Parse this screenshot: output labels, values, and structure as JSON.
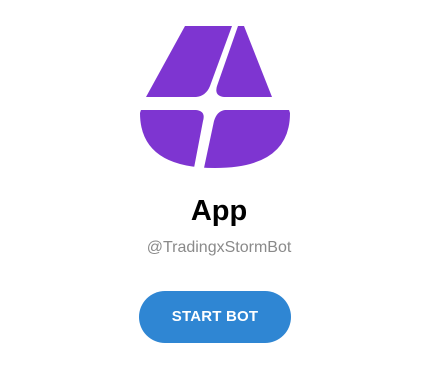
{
  "bot": {
    "name": "App",
    "username": "@TradingxStormBot",
    "logo_icon": "storm-logo-icon",
    "logo_color": "#7e35d1"
  },
  "actions": {
    "start_label": "START BOT",
    "start_color": "#2f86d3"
  }
}
